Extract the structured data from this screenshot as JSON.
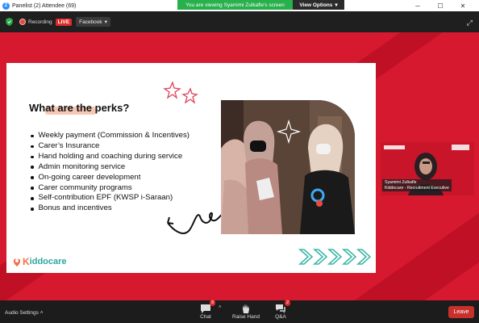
{
  "window": {
    "title": "Panelist (2) Attendee (69)",
    "minimize": "─",
    "maximize": "☐",
    "close": "✕"
  },
  "share_banner": {
    "message": "You are viewing Syamimi Zulkafle's screen",
    "view_options": "View Options"
  },
  "topbar": {
    "recording_label": "Recording",
    "live_badge": "LIVE",
    "stream_target": "Facebook"
  },
  "slide": {
    "title": "What are the perks?",
    "perks": [
      "Weekly payment (Commission & Incentives)",
      "Carer’s Insurance",
      "Hand holding and coaching during service",
      "Admin monitoring service",
      "On-going career development",
      "Carer community programs",
      "Self-contribution EPF (KWSP i-Saraan)",
      "Bonus and incentives"
    ],
    "logo_k": "K",
    "logo_rest": "iddocare",
    "colors": {
      "accent": "#f36f4a",
      "teal": "#2aa7a0",
      "highlight": "#f6c8b4"
    }
  },
  "speaker": {
    "name_line1": "Syamimi Zulkafle",
    "name_line2": "Kiddocare - Recruitment Executive"
  },
  "bottombar": {
    "audio_settings": "Audio Settings",
    "chat_label": "Chat",
    "chat_badge": "8",
    "raise_hand_label": "Raise Hand",
    "qa_label": "Q&A",
    "qa_badge": "2",
    "leave_label": "Leave"
  },
  "colors": {
    "stage_red": "#d6192e",
    "live_red": "#e02b2b",
    "banner_green": "#27b04b"
  }
}
